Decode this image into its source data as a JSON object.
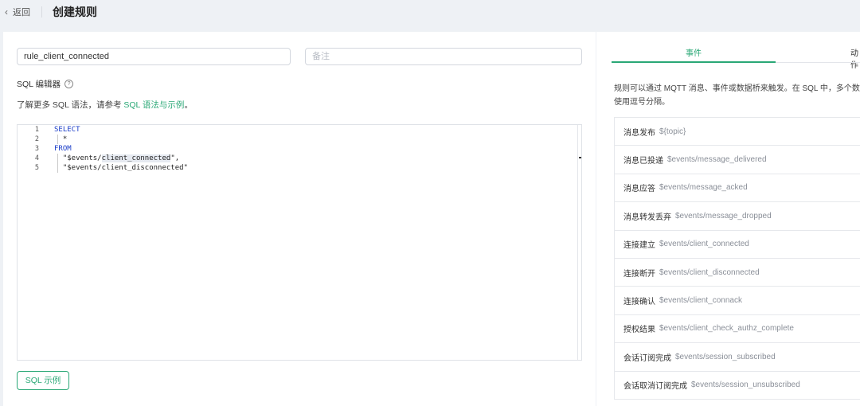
{
  "header": {
    "back_label": "返回",
    "title": "创建规则"
  },
  "form": {
    "rule_name_value": "rule_client_connected",
    "note_placeholder": "备注",
    "sql_editor_label": "SQL 编辑器",
    "hint_prefix": "了解更多 SQL 语法，请参考",
    "hint_link": "SQL 语法与示例",
    "hint_suffix": "。"
  },
  "editor": {
    "line_numbers": [
      "1",
      "2",
      "3",
      "4",
      "5"
    ],
    "lines": {
      "l1": "SELECT",
      "l2": "  *",
      "l3": "FROM",
      "l4_pre": "  \"$events/",
      "l4_hl": "client_connected",
      "l4_post": "\",",
      "l5": "  \"$events/client_disconnected\""
    }
  },
  "buttons": {
    "sql_example": "SQL 示例"
  },
  "tabs": {
    "events": "事件",
    "actions": "动作"
  },
  "description": "规则可以通过 MQTT 消息、事件或数据桥来触发。在 SQL 中，多个数据源使用逗号分隔。",
  "events": [
    {
      "name": "消息发布",
      "topic": "${topic}"
    },
    {
      "name": "消息已投递",
      "topic": "$events/message_delivered"
    },
    {
      "name": "消息应答",
      "topic": "$events/message_acked"
    },
    {
      "name": "消息转发丢弃",
      "topic": "$events/message_dropped"
    },
    {
      "name": "连接建立",
      "topic": "$events/client_connected"
    },
    {
      "name": "连接断开",
      "topic": "$events/client_disconnected"
    },
    {
      "name": "连接确认",
      "topic": "$events/client_connack"
    },
    {
      "name": "授权结果",
      "topic": "$events/client_check_authz_complete"
    },
    {
      "name": "会话订阅完成",
      "topic": "$events/session_subscribed"
    },
    {
      "name": "会话取消订阅完成",
      "topic": "$events/session_unsubscribed"
    }
  ],
  "colors": {
    "accent": "#2aa876",
    "keyword": "#1a3cc8",
    "background": "#eef1f5"
  }
}
